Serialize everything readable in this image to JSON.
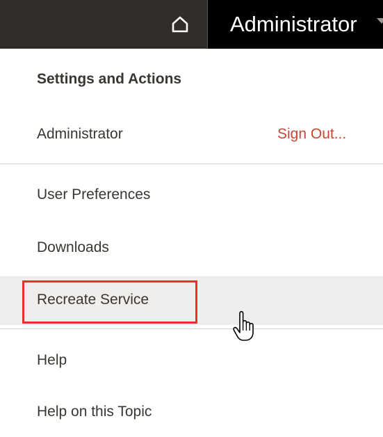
{
  "topbar": {
    "home_icon": "home-icon",
    "user_label": "Administrator",
    "caret_icon": "chevron-down-icon"
  },
  "menu": {
    "header": "Settings and Actions",
    "user_row": {
      "name": "Administrator",
      "sign_out": "Sign Out..."
    },
    "items": [
      {
        "label": "User Preferences"
      },
      {
        "label": "Downloads"
      },
      {
        "label": "Recreate Service",
        "hovered": true,
        "highlighted": true
      },
      {
        "label": "Help"
      },
      {
        "label": "Help on this Topic"
      }
    ]
  },
  "colors": {
    "topbar_bg": "#312d2a",
    "user_button_bg": "#000000",
    "sign_out_text": "#c74634",
    "highlight_border": "#e8312f",
    "hover_bg": "#efeeed"
  },
  "cursor": "hand-pointer-cursor"
}
